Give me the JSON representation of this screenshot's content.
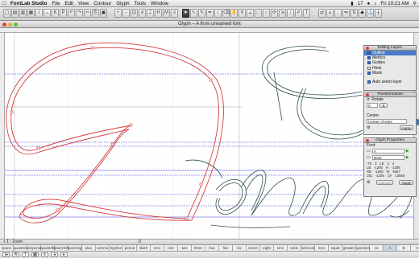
{
  "menubar": {
    "app": "FontLab Studio",
    "items": [
      "File",
      "Edit",
      "View",
      "Contour",
      "Glyph",
      "Tools",
      "Window"
    ],
    "status": {
      "battery": "17",
      "clock": "Fri 10:21 AM"
    }
  },
  "window": {
    "title": "Glyph – A from unnamed font"
  },
  "panels": {
    "editing_layers": {
      "title": "Editing Layers",
      "layers": [
        {
          "label": "Outline",
          "checked": true,
          "selected": true
        },
        {
          "label": "Metrics",
          "checked": true,
          "selected": false
        },
        {
          "label": "Guides",
          "checked": true,
          "selected": false
        },
        {
          "label": "Hints",
          "checked": false,
          "selected": false
        },
        {
          "label": "Mask",
          "checked": true,
          "selected": false
        }
      ],
      "auto_select": "Auto select layer"
    },
    "transformation": {
      "title": "Transformation",
      "rotate_label": "Rotate",
      "rotate_value": "0",
      "center_label": "Center:",
      "center_value": "Center of selct",
      "apply": "Apply"
    },
    "glyph_properties": {
      "title": "Glyph Properties",
      "font_label": "Font:",
      "name_value": "A",
      "unicode_value": "0041",
      "metrics": [
        [
          "-76",
          "3",
          "LE",
          "2",
          "4"
        ],
        [
          "LB",
          "-1206",
          "H",
          "-1206"
        ],
        [
          "RB",
          "-1206",
          "W",
          "5257"
        ],
        [
          "181",
          "-1205",
          "CF",
          "13048"
        ]
      ],
      "cancel": "Cancel",
      "apply": "Apply"
    }
  },
  "statusbar": {
    "left": "< 1 :  Zoom",
    "center": "0"
  },
  "glyph_cells": [
    "space",
    "quotesingle",
    "ampersand",
    "quotedbl",
    "parenleft",
    "parenright",
    "plus",
    "comma",
    "hyphen",
    "period",
    "slash",
    "zero",
    "one",
    "two",
    "three",
    "four",
    "five",
    "six",
    "seven",
    "eight",
    "nine",
    "colon",
    "semicolon",
    "less",
    "equal",
    "greater",
    "question",
    "at",
    "A",
    "B",
    "C",
    "D",
    "E"
  ],
  "colors": {
    "outline_red": "#d43a3a",
    "outline_dark": "#2f4d4b",
    "guide_blue": "#3a3ae6",
    "selection_blue": "#4a7cc9"
  }
}
